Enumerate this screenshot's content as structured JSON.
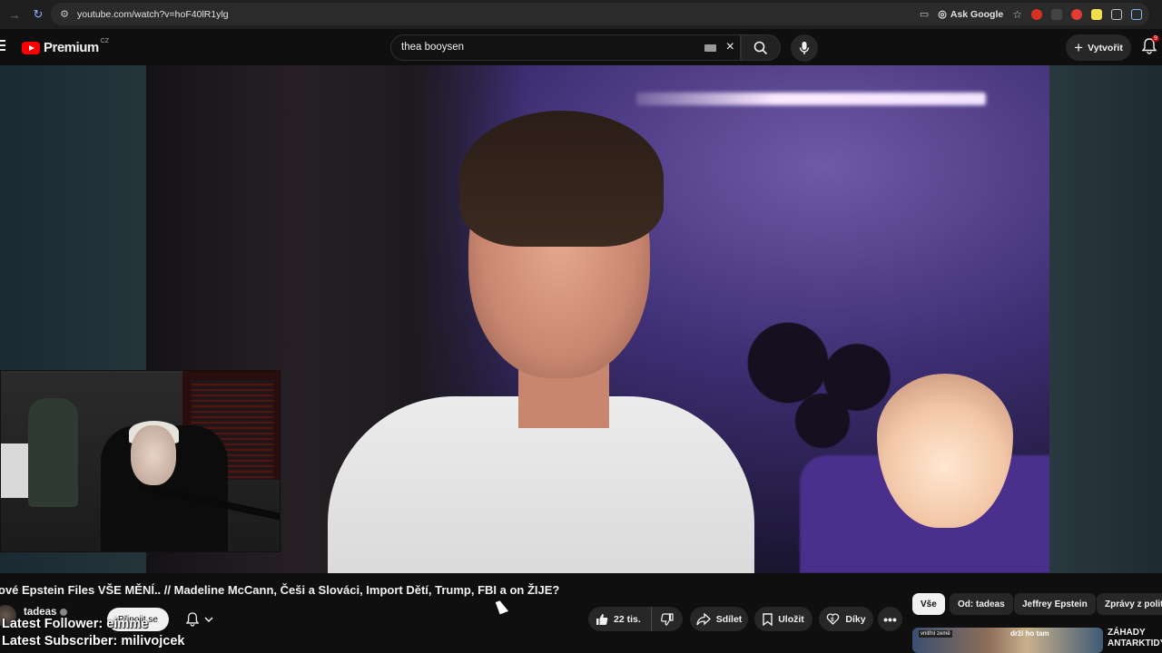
{
  "browser": {
    "url": "youtube.com/watch?v=hoF40lR1ylg",
    "ask_google_label": "Ask Google"
  },
  "header": {
    "logo_text": "Premium",
    "logo_country": "CZ",
    "search_query": "thea booysen",
    "create_label": "Vytvořit",
    "notification_count": "9"
  },
  "video": {
    "title": "ové Epstein Files VŠE MĚNÍ.. // Madeline McCann, Češi a Slováci, Import Dětí, Trump, FBI a on ŽIJE?",
    "channel_name": "tadeas",
    "join_label": "Připojit se",
    "like_count": "22 tis.",
    "share_label": "Sdílet",
    "save_label": "Uložit",
    "thanks_label": "Díky"
  },
  "stream_overlay": {
    "latest_follower": "Latest Follower: eimme",
    "latest_subscriber": "Latest Subscriber: milivojcek"
  },
  "chips": [
    "Vše",
    "Od: tadeas",
    "Jeffrey Epstein",
    "Zprávy z politiky"
  ],
  "recommendation": {
    "thumb_text_left": "vnitřní země",
    "thumb_text_mid": "drží ho tam",
    "title_line1": "ZÁHADY",
    "title_line2": "ANTARKTIDY"
  },
  "colors": {
    "background": "#0f0f0f",
    "brand_red": "#ff0000",
    "pill": "#272727",
    "text": "#f1f1f1"
  }
}
